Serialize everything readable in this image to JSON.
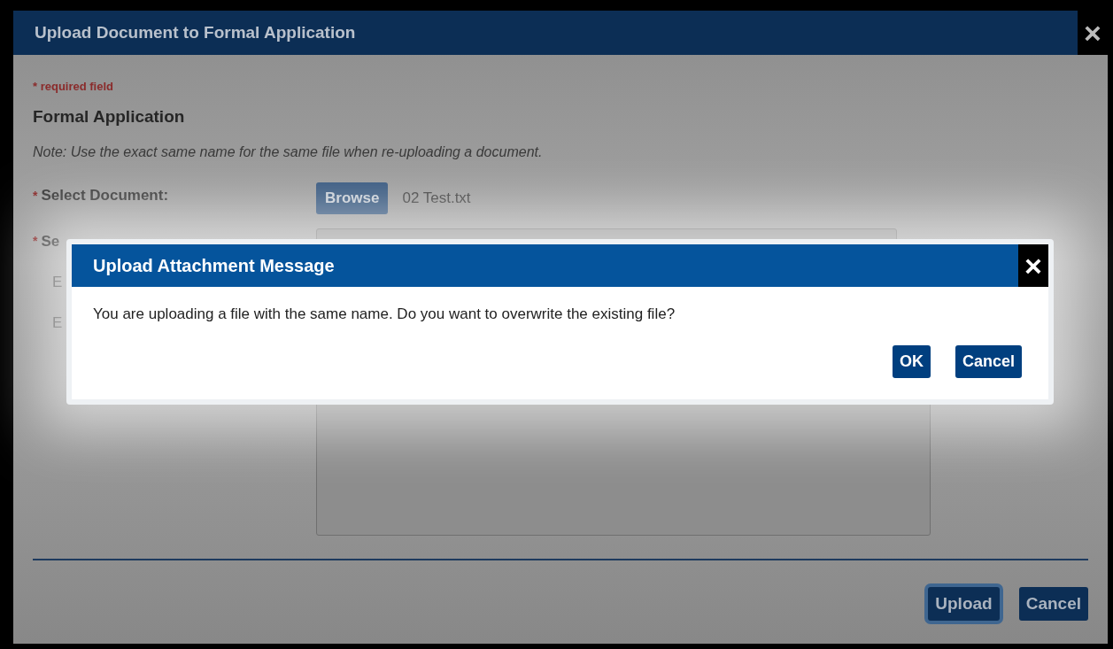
{
  "dialog": {
    "title": "Upload Document to Formal Application",
    "close": "×",
    "required_note": "* required field",
    "heading": "Formal Application",
    "note": "Note: Use the exact same name for the same file when re-uploading a document.",
    "fields": [
      {
        "label": "Select Document:",
        "mark": "*",
        "kind": "file",
        "button": "Browse",
        "value": "02 Test.txt"
      },
      {
        "label": "Se",
        "mark": "*",
        "kind": "select"
      },
      {
        "label": "E",
        "kind": "text"
      },
      {
        "label": "E",
        "kind": "textarea"
      }
    ],
    "buttons": [
      {
        "label": "Upload",
        "focused": true
      },
      {
        "label": "Cancel",
        "focused": false
      }
    ]
  },
  "message": {
    "title": "Upload Attachment Message",
    "close": "×",
    "text": "You are uploading a file with the same name. Do you want to overwrite the existing file?",
    "buttons": [
      "OK",
      "Cancel"
    ]
  }
}
